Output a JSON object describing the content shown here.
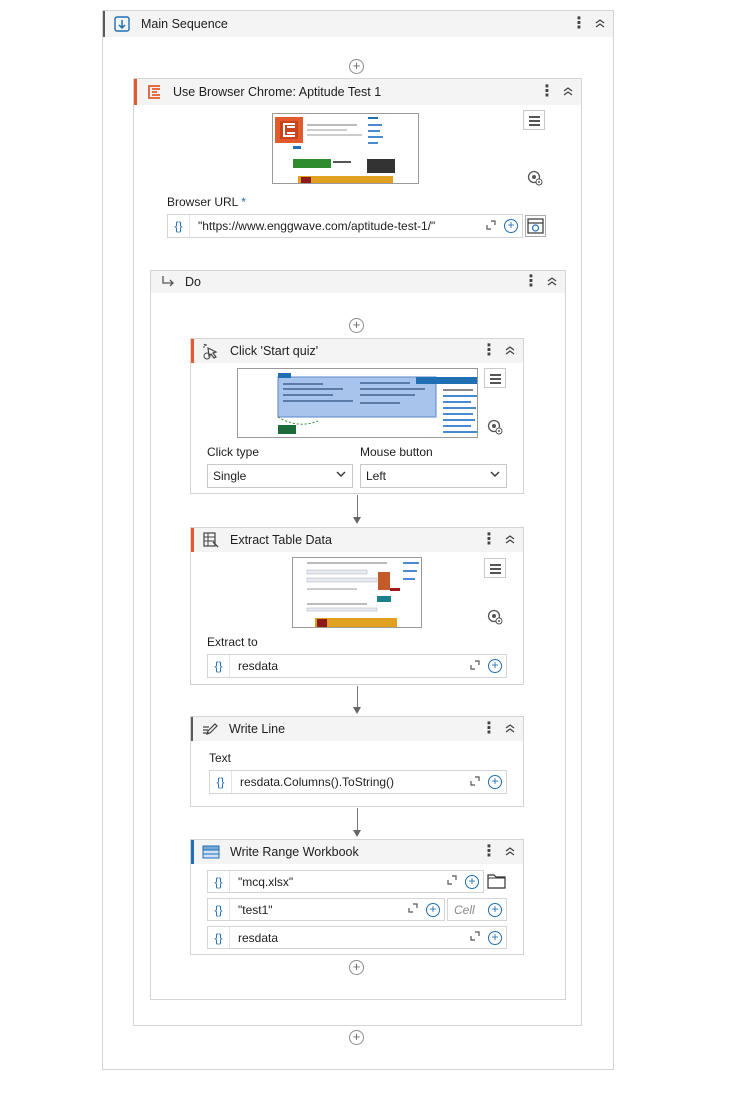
{
  "main_sequence": {
    "title": "Main Sequence"
  },
  "use_browser": {
    "title": "Use Browser Chrome: Aptitude Test 1",
    "url_label": "Browser URL",
    "url_required": "*",
    "url_value": "\"https://www.enggwave.com/aptitude-test-1/\""
  },
  "do": {
    "title": "Do"
  },
  "click_activity": {
    "title": "Click 'Start quiz'",
    "click_type_label": "Click type",
    "click_type_value": "Single",
    "mouse_button_label": "Mouse button",
    "mouse_button_value": "Left"
  },
  "extract_activity": {
    "title": "Extract Table Data",
    "extract_to_label": "Extract to",
    "extract_to_value": "resdata"
  },
  "write_line": {
    "title": "Write Line",
    "text_label": "Text",
    "text_value": "resdata.Columns().ToString()"
  },
  "write_range": {
    "title": "Write Range Workbook",
    "workbook_value": "\"mcq.xlsx\"",
    "sheet_value": "\"test1\"",
    "cell_placeholder": "Cell",
    "data_value": "resdata"
  },
  "glyphs": {
    "brace": "{}",
    "plus": "+",
    "kebab": "⋮",
    "collapse": "︽",
    "expand": "⤢",
    "caret": "⌄"
  },
  "colors": {
    "accent_orange": "#e35b2c",
    "accent_blue": "#1f6fb5",
    "header_bg": "#f4f4f4",
    "border": "#d4d4d4"
  }
}
